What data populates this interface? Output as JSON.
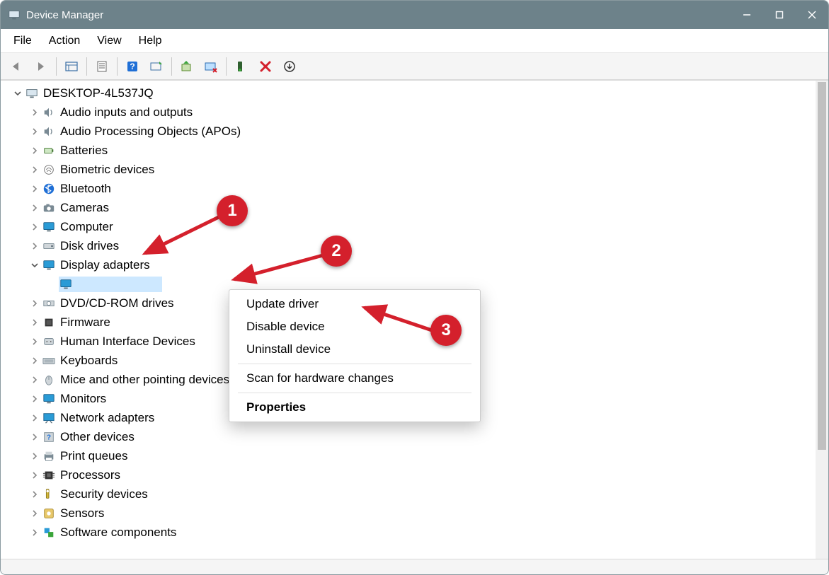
{
  "title": "Device Manager",
  "menu": {
    "file": "File",
    "action": "Action",
    "view": "View",
    "help": "Help"
  },
  "computer_name": "DESKTOP-4L537JQ",
  "categories": [
    {
      "label": "Audio inputs and outputs",
      "icon": "speaker-icon"
    },
    {
      "label": "Audio Processing Objects (APOs)",
      "icon": "speaker-icon"
    },
    {
      "label": "Batteries",
      "icon": "battery-icon"
    },
    {
      "label": "Biometric devices",
      "icon": "fingerprint-icon"
    },
    {
      "label": "Bluetooth",
      "icon": "bluetooth-icon"
    },
    {
      "label": "Cameras",
      "icon": "camera-icon"
    },
    {
      "label": "Computer",
      "icon": "monitor-icon"
    },
    {
      "label": "Disk drives",
      "icon": "disk-icon"
    },
    {
      "label": "Display adapters",
      "icon": "monitor-icon",
      "expanded": true
    },
    {
      "label": "DVD/CD-ROM drives",
      "icon": "optical-icon"
    },
    {
      "label": "Firmware",
      "icon": "chip-icon"
    },
    {
      "label": "Human Interface Devices",
      "icon": "hid-icon"
    },
    {
      "label": "Keyboards",
      "icon": "keyboard-icon"
    },
    {
      "label": "Mice and other pointing devices",
      "icon": "mouse-icon"
    },
    {
      "label": "Monitors",
      "icon": "monitor-icon"
    },
    {
      "label": "Network adapters",
      "icon": "network-icon"
    },
    {
      "label": "Other devices",
      "icon": "unknown-icon"
    },
    {
      "label": "Print queues",
      "icon": "printer-icon"
    },
    {
      "label": "Processors",
      "icon": "cpu-icon"
    },
    {
      "label": "Security devices",
      "icon": "security-icon"
    },
    {
      "label": "Sensors",
      "icon": "sensor-icon"
    },
    {
      "label": "Software components",
      "icon": "software-icon"
    }
  ],
  "selected_device_label": "",
  "context_menu": {
    "update": "Update driver",
    "disable": "Disable device",
    "uninstall": "Uninstall device",
    "scan": "Scan for hardware changes",
    "properties": "Properties"
  },
  "annotations": {
    "badge1": "1",
    "badge2": "2",
    "badge3": "3"
  }
}
